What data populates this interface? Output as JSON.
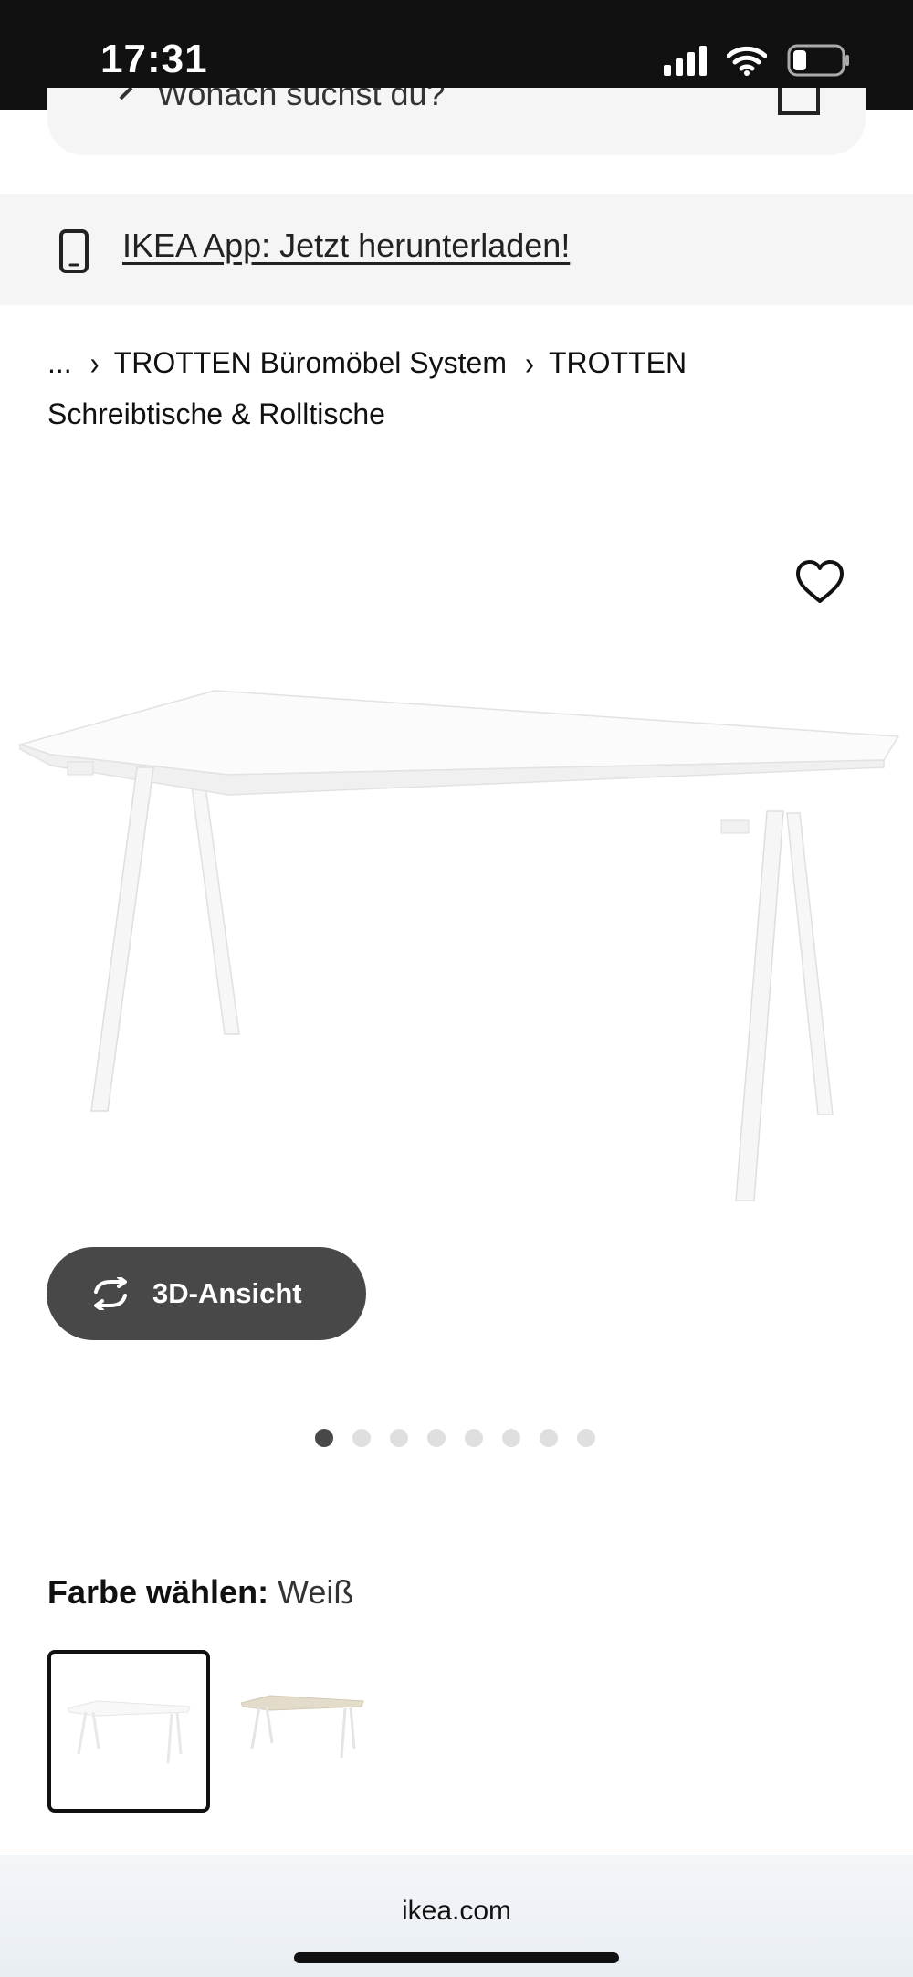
{
  "status_bar": {
    "time": "17:31",
    "icons": [
      "signal-icon",
      "wifi-icon",
      "battery-icon"
    ]
  },
  "search": {
    "placeholder": "Wonach suchst du?"
  },
  "app_banner": {
    "icon": "phone-icon",
    "link_text": "IKEA App: Jetzt herunterladen!"
  },
  "breadcrumb": {
    "ellipsis": "...",
    "items": [
      "TROTTEN Büromöbel System",
      "TROTTEN Schreibtische & Rolltische"
    ]
  },
  "product": {
    "favorite_icon": "heart-icon",
    "image": "white-desk-image",
    "view_3d_label": "3D-Ansicht",
    "view_3d_icon": "rotate-icon",
    "image_count": 8,
    "active_image_index": 0
  },
  "color_selector": {
    "label": "Farbe wählen:",
    "selected_value": "Weiß",
    "options": [
      "white-desk-swatch",
      "beige-desk-swatch"
    ]
  },
  "browser": {
    "url": "ikea.com"
  },
  "colors": {
    "status_bar_bg": "#111111",
    "banner_bg": "#f5f5f5",
    "button_dark": "#484848",
    "text": "#111111"
  }
}
